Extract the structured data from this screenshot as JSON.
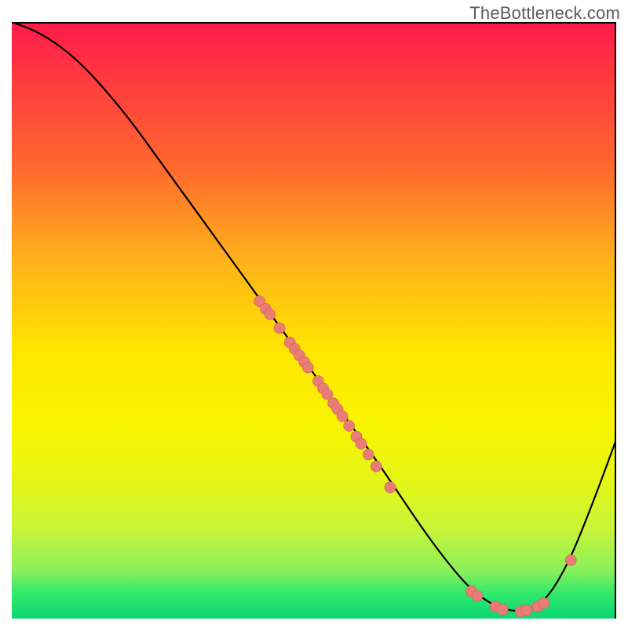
{
  "attribution": "TheBottleneck.com",
  "colors": {
    "line": "#000000",
    "dot": "#e97c74",
    "dot_stroke": "#cf6058"
  },
  "chart_data": {
    "type": "line",
    "title": "",
    "xlabel": "",
    "ylabel": "",
    "xlim": [
      0,
      100
    ],
    "ylim": [
      0,
      100
    ],
    "grid": false,
    "series": [
      {
        "name": "curve",
        "x": [
          0,
          4,
          8,
          12,
          16,
          20,
          25,
          30,
          35,
          40,
          45,
          50,
          55,
          60,
          64,
          68,
          72,
          76,
          80,
          84,
          88,
          92,
          96,
          100
        ],
        "y": [
          100,
          98.5,
          96,
          92.5,
          88,
          83,
          76,
          69,
          62,
          55,
          48,
          41,
          34,
          27,
          21,
          15,
          9.5,
          4.8,
          2,
          1,
          2.5,
          9,
          19,
          30
        ]
      }
    ],
    "dots": [
      {
        "x": 41,
        "y": 53.2
      },
      {
        "x": 42,
        "y": 51.9
      },
      {
        "x": 42.7,
        "y": 51.0
      },
      {
        "x": 44.3,
        "y": 48.7
      },
      {
        "x": 46.0,
        "y": 46.3
      },
      {
        "x": 46.8,
        "y": 45.2
      },
      {
        "x": 47.6,
        "y": 44.1
      },
      {
        "x": 48.4,
        "y": 43.0
      },
      {
        "x": 49.0,
        "y": 42.1
      },
      {
        "x": 50.7,
        "y": 39.8
      },
      {
        "x": 51.5,
        "y": 38.6
      },
      {
        "x": 52.2,
        "y": 37.6
      },
      {
        "x": 53.2,
        "y": 36.1
      },
      {
        "x": 53.9,
        "y": 35.1
      },
      {
        "x": 54.7,
        "y": 33.9
      },
      {
        "x": 55.8,
        "y": 32.3
      },
      {
        "x": 57.0,
        "y": 30.5
      },
      {
        "x": 57.8,
        "y": 29.3
      },
      {
        "x": 59.0,
        "y": 27.5
      },
      {
        "x": 60.3,
        "y": 25.5
      },
      {
        "x": 62.6,
        "y": 22.0
      },
      {
        "x": 76.0,
        "y": 4.6
      },
      {
        "x": 77.0,
        "y": 3.8
      },
      {
        "x": 80.0,
        "y": 2.0
      },
      {
        "x": 81.2,
        "y": 1.5
      },
      {
        "x": 84.2,
        "y": 1.2
      },
      {
        "x": 85.2,
        "y": 1.4
      },
      {
        "x": 87.0,
        "y": 2.0
      },
      {
        "x": 88.0,
        "y": 2.6
      },
      {
        "x": 92.5,
        "y": 9.8
      }
    ]
  }
}
